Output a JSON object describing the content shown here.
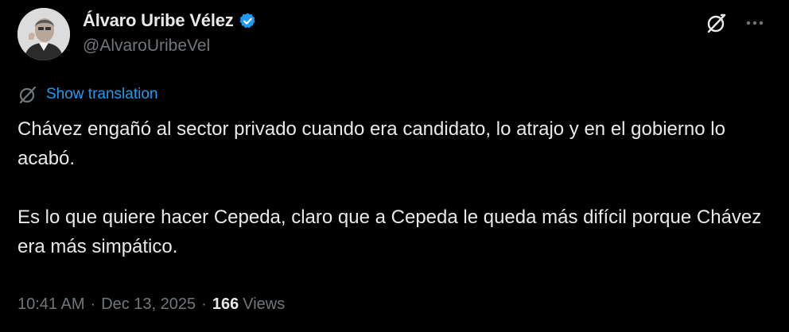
{
  "author": {
    "display_name": "Álvaro Uribe Vélez",
    "handle": "@AlvaroUribeVel",
    "verified": true,
    "verified_color": "#1d9bf0"
  },
  "actions": {
    "grok_icon": "grok-icon",
    "more_icon": "more-icon"
  },
  "translation": {
    "label": "Show translation",
    "icon": "translate-icon",
    "color": "#1d9bf0"
  },
  "tweet": {
    "paragraphs": [
      "Chávez engañó al sector privado cuando era candidato, lo atrajo y en el gobierno lo acabó.",
      "Es lo que quiere hacer Cepeda, claro que a Cepeda le queda más difícil porque Chávez era más simpático."
    ]
  },
  "meta": {
    "time": "10:41 AM",
    "separator": "·",
    "date": "Dec 13, 2025",
    "views_count": "166",
    "views_label": "Views"
  },
  "colors": {
    "background": "#000000",
    "text": "#e7e9ea",
    "secondary": "#71767b",
    "accent": "#1d9bf0"
  }
}
